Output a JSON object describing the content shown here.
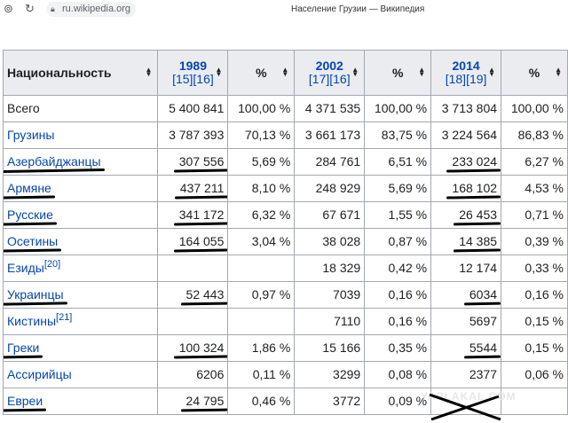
{
  "browser": {
    "url": "ru.wikipedia.org",
    "title": "Население Грузии — Википедия"
  },
  "table": {
    "headers": {
      "nationality": "Национальность",
      "y1989": "1989",
      "ref1989": "[15][16]",
      "y2002": "2002",
      "ref2002": "[17][16]",
      "y2014": "2014",
      "ref2014": "[18][19]",
      "pct": "%"
    },
    "rows": [
      {
        "name": "Всего",
        "v1989": "5 400 841",
        "p1989": "100,00 %",
        "v2002": "4 371 535",
        "p2002": "100,00 %",
        "v2014": "3 713 804",
        "p2014": "100,00 %"
      },
      {
        "name": "Грузины",
        "v1989": "3 787 393",
        "p1989": "70,13 %",
        "v2002": "3 661 173",
        "p2002": "83,75 %",
        "v2014": "3 224 564",
        "p2014": "86,83 %"
      },
      {
        "name": "Азербайджанцы",
        "v1989": "307 556",
        "p1989": "5,69 %",
        "v2002": "284 761",
        "p2002": "6,51 %",
        "v2014": "233 024",
        "p2014": "6,27 %"
      },
      {
        "name": "Армяне",
        "v1989": "437 211",
        "p1989": "8,10 %",
        "v2002": "248 929",
        "p2002": "5,69 %",
        "v2014": "168 102",
        "p2014": "4,53 %"
      },
      {
        "name": "Русские",
        "v1989": "341 172",
        "p1989": "6,32 %",
        "v2002": "67 671",
        "p2002": "1,55 %",
        "v2014": "26 453",
        "p2014": "0,71 %"
      },
      {
        "name": "Осетины",
        "v1989": "164 055",
        "p1989": "3,04 %",
        "v2002": "38 028",
        "p2002": "0,87 %",
        "v2014": "14 385",
        "p2014": "0,39 %"
      },
      {
        "name": "Езиды",
        "ref": "[20]",
        "v1989": "",
        "p1989": "",
        "v2002": "18 329",
        "p2002": "0,42 %",
        "v2014": "12 174",
        "p2014": "0,33 %"
      },
      {
        "name": "Украинцы",
        "v1989": "52 443",
        "p1989": "0,97 %",
        "v2002": "7039",
        "p2002": "0,16 %",
        "v2014": "6034",
        "p2014": "0,16 %"
      },
      {
        "name": "Кистины",
        "ref": "[21]",
        "v1989": "",
        "p1989": "",
        "v2002": "7110",
        "p2002": "0,16 %",
        "v2014": "5697",
        "p2014": "0,15 %"
      },
      {
        "name": "Греки",
        "v1989": "100 324",
        "p1989": "1,86 %",
        "v2002": "15 166",
        "p2002": "0,35 %",
        "v2014": "5544",
        "p2014": "0,15 %"
      },
      {
        "name": "Ассирийцы",
        "v1989": "6206",
        "p1989": "0,11 %",
        "v2002": "3299",
        "p2002": "0,08 %",
        "v2014": "2377",
        "p2014": "0,06 %"
      },
      {
        "name": "Евреи",
        "v1989": "24 795",
        "p1989": "0,46 %",
        "v2002": "3772",
        "p2002": "0,09 %",
        "v2014": "",
        "p2014": ""
      }
    ]
  },
  "watermark": "YAPLAKAL.COM"
}
